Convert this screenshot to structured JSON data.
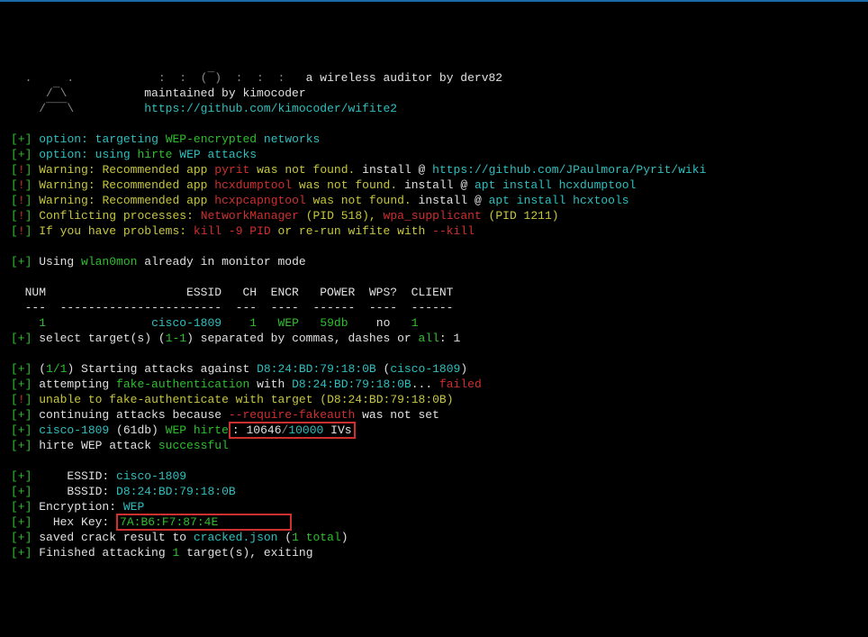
{
  "ascii": {
    "l1a": "  .     .         ",
    "l1b": "   :  :  (¯)  :  :  :   ",
    "l1c": "a wireless auditor by derv82",
    "l2a": "     /¯\\           ",
    "l2b": "maintained by kimocoder",
    "l3a": "    /¯¯¯\\          ",
    "l3b": "https://github.com/kimocoder/wifite2"
  },
  "opt1": {
    "pre": "option: targeting ",
    "green": "WEP-encrypted",
    "post": " networks"
  },
  "opt2": {
    "pre": "option: using ",
    "green": "hirte",
    "post": " WEP attacks"
  },
  "warn1": {
    "a": "Warning: Recommended app ",
    "app": "pyrit",
    "b": " was not found. ",
    "c": "install @ ",
    "link": "https://github.com/JPaulmora/Pyrit/wiki"
  },
  "warn2": {
    "a": "Warning: Recommended app ",
    "app": "hcxdumptool",
    "b": " was not found. ",
    "c": "install @ ",
    "cmd": "apt install hcxdumptool"
  },
  "warn3": {
    "a": "Warning: Recommended app ",
    "app": "hcxpcapngtool",
    "b": " was not found. ",
    "c": "install @ ",
    "cmd": "apt install hcxtools"
  },
  "conf": {
    "a": "Conflicting processes: ",
    "p1": "NetworkManager",
    "pid1": " (PID 518)",
    "sep": ", ",
    "p2": "wpa_supplicant",
    "pid2": " (PID 1211)"
  },
  "help": {
    "a": "If you have problems: ",
    "k": "kill -9 PID",
    "b": " or re-run wifite with ",
    "flag": "--kill"
  },
  "using": {
    "a": "Using ",
    "iface": "wlan0mon",
    "b": " already in monitor mode"
  },
  "hdr": "  NUM                    ESSID   CH  ENCR   POWER  WPS?  CLIENT",
  "hdr2": "  ---  -----------------------  ---  ----  ------  ----  ------",
  "row": {
    "num": "1",
    "essid": "cisco-1809",
    "ch": "1",
    "encr": "WEP",
    "power": "59db",
    "wps": "no",
    "client": "1"
  },
  "sel": {
    "a": "select target(s) (",
    "r": "1-1",
    "b": ") separated by commas, dashes or ",
    "all": "all",
    "c": ": 1"
  },
  "atk1": {
    "a": "(",
    "n": "1/1",
    "b": ") Starting attacks against ",
    "mac": "D8:24:BD:79:18:0B",
    "c": " (",
    "ess": "cisco-1809",
    "d": ")"
  },
  "atk2": {
    "a": "attempting ",
    "fa": "fake-authentication",
    "b": " with ",
    "mac": "D8:24:BD:79:18:0B",
    "dots": "... ",
    "fail": "failed"
  },
  "atk3": "unable to fake-authenticate with target (D8:24:BD:79:18:0B)",
  "atk4": {
    "a": "continuing attacks because ",
    "flag": "--require-fakeauth",
    "b": " was not set"
  },
  "atk5": {
    "ess": "cisco-1809",
    "db": " (61db) ",
    "wep": "WEP ",
    "h": "hirte",
    "colon": ": ",
    "ivs": "10646",
    "slash": "/",
    "tot": "10000",
    "iv": " IVs"
  },
  "atk6": {
    "a": "hirte WEP attack ",
    "s": "successful"
  },
  "res": {
    "essid_l": "    ESSID: ",
    "essid": "cisco-1809",
    "bssid_l": "    BSSID: ",
    "bssid": "D8:24:BD:79:18:0B",
    "enc_l": "Encryption: ",
    "enc": "WEP",
    "key_l": "  Hex Key: ",
    "key": "7A:B6:F7:87:4E"
  },
  "save": {
    "a": "saved crack result to ",
    "f": "cracked.json",
    "b": " (",
    "n": "1 total",
    "c": ")"
  },
  "fin": {
    "a": "Finished attacking ",
    "n": "1",
    "b": " target(s), exiting"
  }
}
